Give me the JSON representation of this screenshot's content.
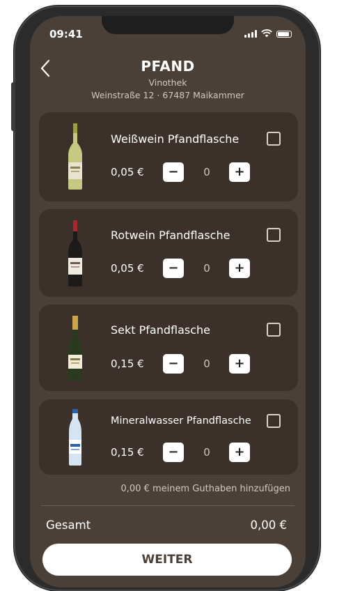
{
  "status_bar": {
    "time": "09:41"
  },
  "header": {
    "title": "PFAND",
    "subtitle": "Vinothek",
    "address": "Weinstraße 12 · 67487 Maikammer"
  },
  "items": [
    {
      "name": "Weißwein Pfandflasche",
      "price": "0,05 €",
      "quantity": "0",
      "minus": "−",
      "plus": "+",
      "checked": false,
      "bottle": "white-wine-bottle"
    },
    {
      "name": "Rotwein Pfandflasche",
      "price": "0,05 €",
      "quantity": "0",
      "minus": "−",
      "plus": "+",
      "checked": false,
      "bottle": "red-wine-bottle"
    },
    {
      "name": "Sekt Pfandflasche",
      "price": "0,15 €",
      "quantity": "0",
      "minus": "−",
      "plus": "+",
      "checked": false,
      "bottle": "sparkling-wine-bottle"
    },
    {
      "name": "Mineralwasser Pfandflasche",
      "price": "0,15 €",
      "quantity": "0",
      "minus": "−",
      "plus": "+",
      "checked": false,
      "bottle": "mineral-water-bottle"
    }
  ],
  "credit_note": "0,00  €  meinem Guthaben hinzufügen",
  "total": {
    "label": "Gesamt",
    "value": "0,00 €"
  },
  "cta": {
    "label": "WEITER"
  },
  "colors": {
    "screen_background": "#4b4037",
    "card_background": "#3b312a",
    "text_primary": "#ffffff",
    "text_secondary": "#cfc8c0"
  }
}
